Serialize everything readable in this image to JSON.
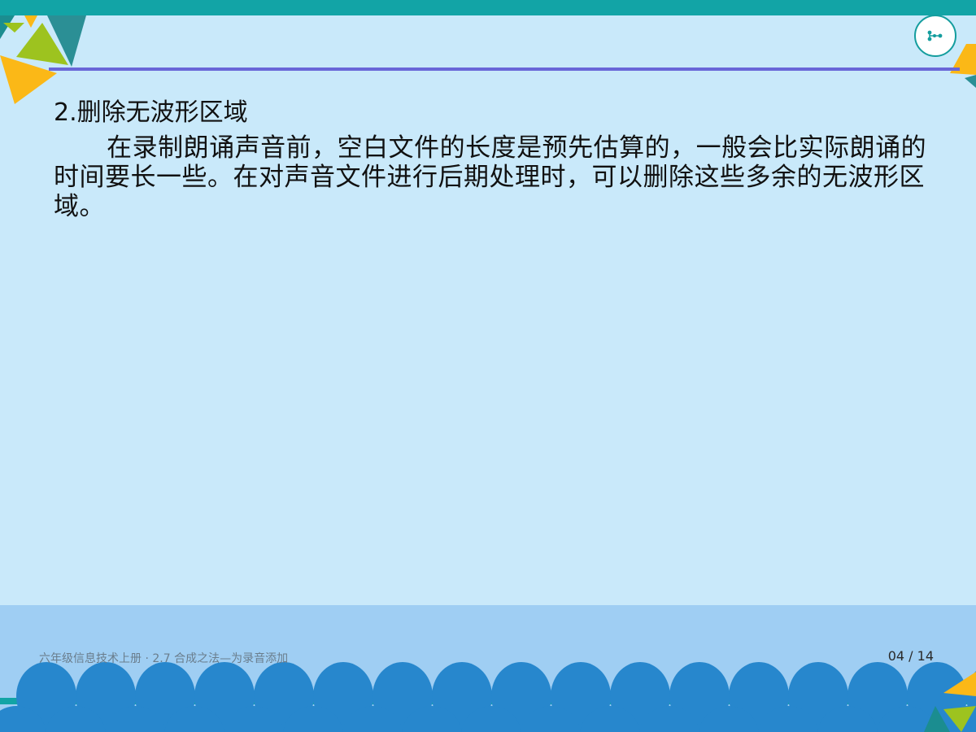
{
  "slide": {
    "heading": "2.删除无波形区域",
    "paragraph": "在录制朗诵声音前，空白文件的长度是预先估算的，一般会比实际朗诵的时间要长一些。在对声音文件进行后期处理时，可以删除这些多余的无波形区域。"
  },
  "footer": {
    "course_title": "六年级信息技术上册 · 2.7 合成之法—为录音添加",
    "page_counter": "04 / 14"
  },
  "navigation": {
    "icon": "share-nodes-icon"
  },
  "colors": {
    "background": "#c9e9fa",
    "top_bar": "#12a4a6",
    "divider": "#6966d8",
    "bottom_band": "#9fcef3",
    "wave_blue": "#2787cd",
    "triangle_yellow": "#fbb817",
    "triangle_green": "#9dc31f",
    "triangle_teal": "#1b8d90"
  }
}
